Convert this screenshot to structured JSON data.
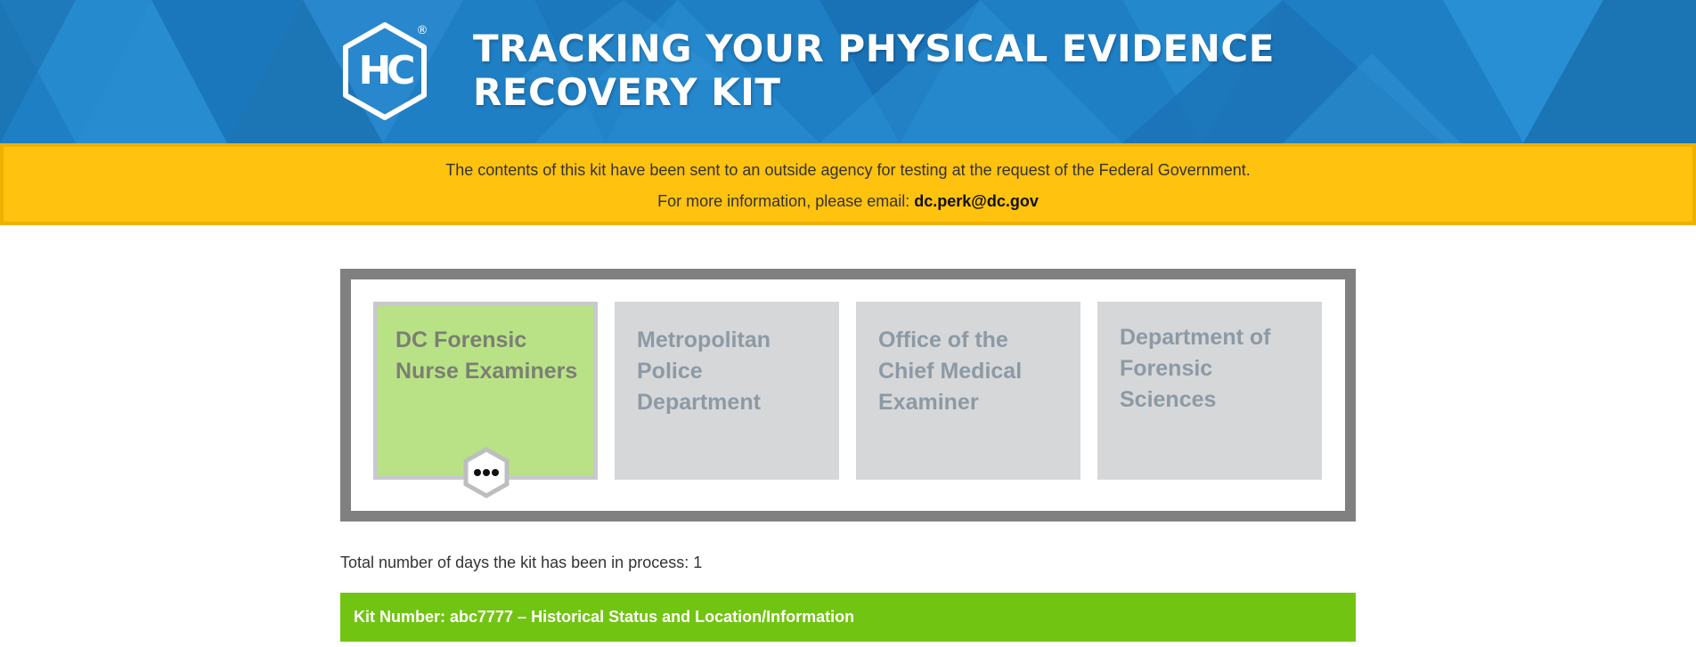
{
  "header": {
    "logo_text": "HC",
    "registered_mark": "®",
    "title_line1": "TRACKING YOUR PHYSICAL EVIDENCE",
    "title_line2": "RECOVERY KIT"
  },
  "notice": {
    "line1": "The contents of this kit have been sent to an outside agency for testing at the request of the Federal Government.",
    "line2_prefix": "For more information, please email: ",
    "email": "dc.perk@dc.gov"
  },
  "tracker": {
    "steps": [
      {
        "label": "DC Forensic Nurse Examiners",
        "active": true
      },
      {
        "label": "Metropolitan Police Department",
        "active": false
      },
      {
        "label": "Office of the Chief Medical Examiner",
        "active": false
      },
      {
        "label": "Department of Forensic Sciences",
        "active": false
      }
    ],
    "marker_icon": "ellipsis-hexagon-icon"
  },
  "status": {
    "days_text": "Total number of days the kit has been in process: 1",
    "kit_bar_text": "Kit Number: abc7777 – Historical Status and Location/Information"
  },
  "colors": {
    "header_blue": "#1f7fc4",
    "notice_yellow": "#ffc20e",
    "active_step_green": "#b9e287",
    "inactive_step_gray": "#d6d7d9",
    "kit_bar_green": "#71c411",
    "tracker_border": "#808080"
  }
}
